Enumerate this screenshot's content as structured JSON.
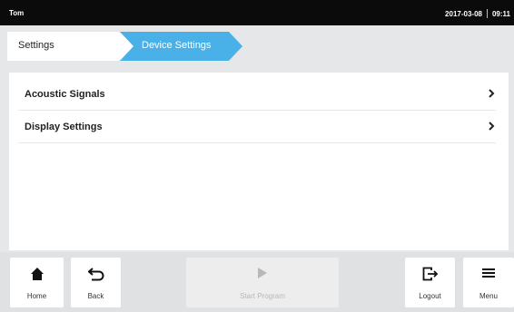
{
  "status_bar": {
    "user": "Tom",
    "date": "2017-03-08",
    "time": "09:11"
  },
  "breadcrumb": {
    "items": [
      {
        "label": "Settings"
      },
      {
        "label": "Device Settings"
      }
    ]
  },
  "menu_list": {
    "items": [
      {
        "label": "Acoustic Signals"
      },
      {
        "label": "Display Settings"
      }
    ]
  },
  "toolbar": {
    "home_label": "Home",
    "back_label": "Back",
    "start_label": "Start Program",
    "logout_label": "Logout",
    "menu_label": "Menu"
  },
  "icons": {
    "home": "home-icon",
    "back": "undo-arrow-icon",
    "start": "play-icon",
    "logout": "logout-icon",
    "menu": "hamburger-icon",
    "chevron": "chevron-right-icon"
  },
  "colors": {
    "status_bar_bg": "#0b0b0b",
    "active_crumb": "#4ab1e8",
    "background": "#e6e7e8",
    "disabled_text": "#b8b8b8"
  }
}
